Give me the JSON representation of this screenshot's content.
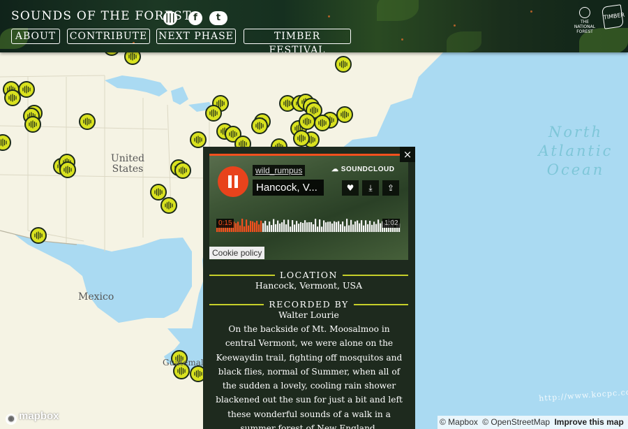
{
  "header": {
    "title": "SOUNDS OF THE FOREST",
    "icons": [
      "sound-icon",
      "facebook-icon",
      "twitter-icon"
    ],
    "nav": [
      "ABOUT",
      "CONTRIBUTE",
      "NEXT PHASE",
      "TIMBER FESTIVAL"
    ],
    "partners": [
      {
        "name": "THE NATIONAL FOREST",
        "icon": "national-forest-logo"
      },
      {
        "name": "TIMBER",
        "icon": "timber-logo"
      }
    ]
  },
  "map": {
    "labels": {
      "ocean": [
        "North",
        "Atlantic",
        "Ocean"
      ],
      "united_states": [
        "United",
        "States"
      ],
      "mexico": "Mexico",
      "guatemala": "Guatemala"
    },
    "marker_icon": "soundwave-marker-icon",
    "colors": {
      "water": "#aadaf2",
      "land": "#f5f3e4",
      "marker": "#d9e21f"
    }
  },
  "popup": {
    "close_label": "×",
    "player": {
      "username": "wild_rumpus",
      "track_title": "Hancock, V...",
      "brand": "SOUNDCLOUD",
      "elapsed": "0:15",
      "duration": "1:02",
      "progress": 0.24,
      "state": "playing",
      "actions": [
        "heart-icon",
        "download-icon",
        "share-icon"
      ],
      "cookie": "Cookie policy"
    },
    "location_heading": "LOCATION",
    "location": "Hancock, Vermont, USA",
    "recorded_heading": "RECORDED BY",
    "recorded_by": "Walter Lourie",
    "description": "On the backside of Mt. Moosalmoo in central Vermont, we were alone on the Keewaydin trail, fighting off mosquitos and black flies, normal of Summer, when all of the sudden a lovely, cooling rain shower blackened out the sun for just a bit and left these wonderful sounds of a walk in a summer forest of New England."
  },
  "attribution": {
    "mapbox": "mapbox",
    "credits": [
      "© Mapbox",
      "© OpenStreetMap"
    ],
    "improve": "Improve this map"
  },
  "watermark": "http://www.kocpc.com.tw/"
}
